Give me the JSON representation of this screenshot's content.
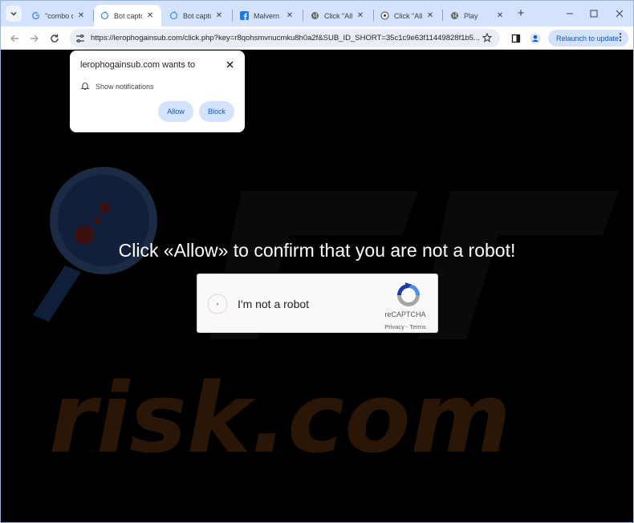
{
  "tabs": [
    {
      "title": "\"combo cl",
      "favicon": "google-icon",
      "active": false
    },
    {
      "title": "Bot captch",
      "favicon": "captcha-favicon-icon",
      "active": true
    },
    {
      "title": "Bot captch",
      "favicon": "captcha-favicon-icon",
      "active": false
    },
    {
      "title": "Malvern Jo",
      "favicon": "facebook-icon",
      "active": false
    },
    {
      "title": "Click \"Allo",
      "favicon": "globe-icon",
      "active": false
    },
    {
      "title": "Click \"Allo",
      "favicon": "soccer-ball-icon",
      "active": false
    },
    {
      "title": "Play",
      "favicon": "globe-icon",
      "active": false
    }
  ],
  "toolbar": {
    "url": "https://lerophogainsub.com/click.php?key=r8qohsmvnucmku8h0a2f&SUB_ID_SHORT=35c1c9e63f11449828f1b5...",
    "relaunch_label": "Relaunch to update"
  },
  "popup": {
    "title": "lerophogainsub.com wants to",
    "permission": "Show notifications",
    "allow_label": "Allow",
    "block_label": "Block"
  },
  "page": {
    "headline": "Click «Allow» to confirm that you are not a robot!",
    "captcha_label": "I'm not a robot",
    "captcha_brand": "reCAPTCHA",
    "captcha_links": "Privacy - Terms"
  },
  "watermark": "risk.com",
  "colors": {
    "tabstrip": "#d3e3fd",
    "accent": "#0b57d0",
    "page_bg": "#000000",
    "watermark": "#3a1e08"
  }
}
